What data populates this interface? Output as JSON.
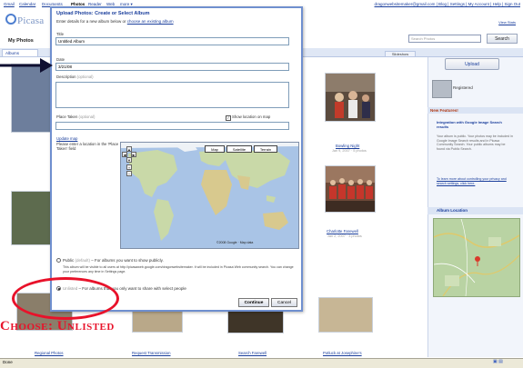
{
  "gbar": {
    "links": [
      "Gmail",
      "Calendar",
      "Documents",
      "Photos",
      "Reader",
      "Web",
      "more ▾"
    ],
    "user_line": "dragonwebsitemaker@gmail.com | Blog | Settings | My Account | Help | Sign Out"
  },
  "header": {
    "logo": "Picasa",
    "view_stats": "View Stats",
    "search_placeholder": "Search Photos",
    "search_button": "Search",
    "my_photos": "My Photos",
    "tab_albums": "Albums",
    "slideshow": "Slideshow"
  },
  "sidebar": {
    "upload_button": "Upload",
    "username": "Registered",
    "new_features_heading": "New Features!",
    "nf_title": "Integration with Google Image Search results",
    "nf_text": "Your album is public. Your photos may be included in Google Image Search results and in Picasa Community Search. Your public albums may be found via Public Search.",
    "nf_link": "To learn more about controlling your privacy and search settings, click here.",
    "album_location_heading": "Album Location"
  },
  "photos": [
    {
      "caption": "",
      "date": ""
    },
    {
      "caption": "Bowling Night",
      "date": "Jan 9, 2007 · 5 photos"
    },
    {
      "caption": "Charlotte Farewell",
      "date": "Jan 2, 2007 · 3 photos"
    },
    {
      "caption": "Regional Photos",
      "date": ""
    },
    {
      "caption": "Request Transmission",
      "date": ""
    },
    {
      "caption": "Search Farewell",
      "date": ""
    },
    {
      "caption": "Potluck at Josephine's",
      "date": ""
    }
  ],
  "modal": {
    "title": "Upload Photos: Create or Select Album",
    "subtitle_prefix": "Enter details for a new album below or ",
    "subtitle_link": "choose an existing album",
    "title_label": "Title",
    "title_value": "Untitled Album",
    "date_label": "Date",
    "date_value": "3/21/08",
    "description_label": "Description",
    "description_hint": "(optional)",
    "place_label": "Place Taken",
    "place_hint": "(optional)",
    "show_location": "Show location on map",
    "update_map": "Update map",
    "map_help": "Please enter a location in the 'Place Taken' field",
    "map_types": [
      "Map",
      "Satellite",
      "Terrain"
    ],
    "map_credit": "©2008 Google · Map data",
    "public_label": "Public",
    "public_hint": "(default)",
    "public_text": " – For albums you want to show publicly.",
    "public_desc": "This album will be visible to all users at http://picasaweb.google.com/dragonwebsitemaker. It will be included in Picasa Web community search. You can change your preferences any time in Settings page.",
    "unlisted_label": "Unlisted",
    "unlisted_text": " – For albums that you only want to share with select people",
    "continue_button": "Continue",
    "cancel_button": "Cancel"
  },
  "annotation": {
    "text": "Choose: Unlisted"
  },
  "statusbar": {
    "text": "Done"
  },
  "colors": {
    "accent": "#1a3e9c",
    "annotation": "#e8122a",
    "modal_border": "#6f8fcf"
  }
}
